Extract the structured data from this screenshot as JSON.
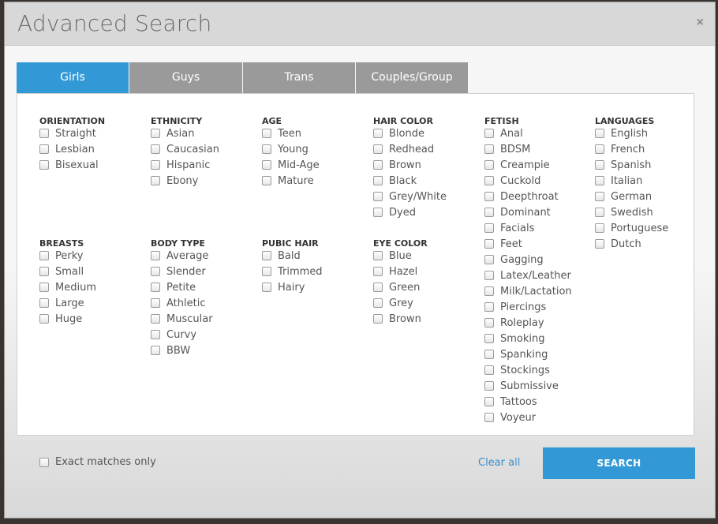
{
  "modal": {
    "title": "Advanced Search",
    "close_icon": "×"
  },
  "tabs": [
    {
      "label": "Girls",
      "active": true
    },
    {
      "label": "Guys",
      "active": false
    },
    {
      "label": "Trans",
      "active": false
    },
    {
      "label": "Couples/Group",
      "active": false
    }
  ],
  "groups": {
    "orientation": {
      "title": "ORIENTATION",
      "options": [
        "Straight",
        "Lesbian",
        "Bisexual"
      ]
    },
    "ethnicity": {
      "title": "ETHNICITY",
      "options": [
        "Asian",
        "Caucasian",
        "Hispanic",
        "Ebony"
      ]
    },
    "age": {
      "title": "AGE",
      "options": [
        "Teen",
        "Young",
        "Mid-Age",
        "Mature"
      ]
    },
    "hair_color": {
      "title": "HAIR COLOR",
      "options": [
        "Blonde",
        "Redhead",
        "Brown",
        "Black",
        "Grey/White",
        "Dyed"
      ]
    },
    "fetish": {
      "title": "FETISH",
      "options": [
        "Anal",
        "BDSM",
        "Creampie",
        "Cuckold",
        "Deepthroat",
        "Dominant",
        "Facials",
        "Feet",
        "Gagging",
        "Latex/Leather",
        "Milk/Lactation",
        "Piercings",
        "Roleplay",
        "Smoking",
        "Spanking",
        "Stockings",
        "Submissive",
        "Tattoos",
        "Voyeur"
      ]
    },
    "languages": {
      "title": "LANGUAGES",
      "options": [
        "English",
        "French",
        "Spanish",
        "Italian",
        "German",
        "Swedish",
        "Portuguese",
        "Dutch"
      ]
    },
    "breasts": {
      "title": "BREASTS",
      "options": [
        "Perky",
        "Small",
        "Medium",
        "Large",
        "Huge"
      ]
    },
    "body_type": {
      "title": "BODY TYPE",
      "options": [
        "Average",
        "Slender",
        "Petite",
        "Athletic",
        "Muscular",
        "Curvy",
        "BBW"
      ]
    },
    "pubic_hair": {
      "title": "PUBIC HAIR",
      "options": [
        "Bald",
        "Trimmed",
        "Hairy"
      ]
    },
    "eye_color": {
      "title": "EYE COLOR",
      "options": [
        "Blue",
        "Hazel",
        "Green",
        "Grey",
        "Brown"
      ]
    }
  },
  "footer": {
    "exact_matches_label": "Exact matches only",
    "clear_all_label": "Clear all",
    "search_label": "SEARCH"
  },
  "colors": {
    "accent": "#3399d6",
    "tab_inactive": "#9a9a9a",
    "link": "#3a8fcc"
  }
}
